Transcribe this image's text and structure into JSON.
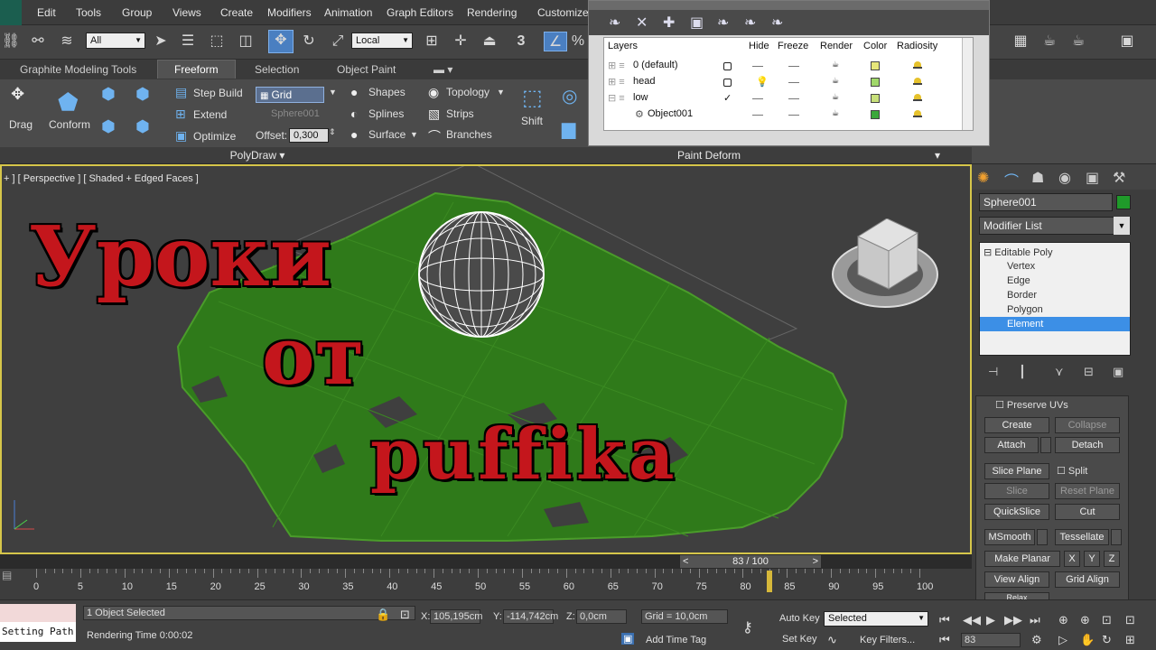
{
  "menu": [
    "Edit",
    "Tools",
    "Group",
    "Views",
    "Create",
    "Modifiers",
    "Animation",
    "Graph Editors",
    "Rendering",
    "Customize"
  ],
  "toolbar": {
    "selection_filter": "All",
    "reference_coord": "Local",
    "snap_label": "3",
    "percent_label": "%"
  },
  "ribbon_tabs": [
    "Graphite Modeling Tools",
    "Freeform",
    "Selection",
    "Object Paint"
  ],
  "ribbon": {
    "drag": "Drag",
    "conform": "Conform",
    "step_build": "Step Build",
    "extend": "Extend",
    "optimize": "Optimize",
    "grid": "Grid",
    "draw_on": "Sphere001",
    "offset_label": "Offset:",
    "offset_value": "0,300",
    "shapes": "Shapes",
    "splines": "Splines",
    "surface": "Surface",
    "topology": "Topology",
    "strips": "Strips",
    "branches": "Branches",
    "shift": "Shift",
    "polydraw": "PolyDraw",
    "paint_deform": "Paint Deform"
  },
  "layer_dialog": {
    "headers": [
      "Layers",
      "Hide",
      "Freeze",
      "Render",
      "Color",
      "Radiosity"
    ],
    "rows": [
      {
        "name": "0 (default)",
        "color": "#e6e67a",
        "icon": "checkbox-icon"
      },
      {
        "name": "head",
        "color": "#a0d86a",
        "icon": "bulb-icon"
      },
      {
        "name": "low",
        "color": "#c8e07a",
        "icon": "check-icon"
      },
      {
        "name": "Object001",
        "color": "#3aa83a",
        "icon": "none"
      }
    ]
  },
  "viewport": {
    "label": "+ ] [ Perspective ] [ Shaded + Edged Faces ]",
    "overlay_line1": "Уроки",
    "overlay_line2": "от",
    "overlay_line3": "puffika"
  },
  "command_panel": {
    "object_name": "Sphere001",
    "modifier_list": "Modifier List",
    "stack": [
      "Editable Poly",
      "Vertex",
      "Edge",
      "Border",
      "Polygon",
      "Element"
    ],
    "selected_index": 5,
    "preserve_uvs": "Preserve UVs",
    "create": "Create",
    "collapse": "Collapse",
    "attach": "Attach",
    "detach": "Detach",
    "slice_plane": "Slice Plane",
    "split": "Split",
    "slice": "Slice",
    "reset_plane": "Reset Plane",
    "quickslice": "QuickSlice",
    "cut": "Cut",
    "msmooth": "MSmooth",
    "tessellate": "Tessellate",
    "make_planar": "Make Planar",
    "x": "X",
    "y": "Y",
    "z": "Z",
    "view_align": "View Align",
    "grid_align": "Grid Align",
    "relax": "Relax"
  },
  "timeline": {
    "slider_text": "83 / 100",
    "current_frame": 83,
    "ticks": [
      "0",
      "5",
      "10",
      "15",
      "20",
      "25",
      "30",
      "35",
      "40",
      "45",
      "50",
      "55",
      "60",
      "65",
      "70",
      "75",
      "80",
      "85",
      "90",
      "95",
      "100"
    ]
  },
  "status": {
    "script_text": "Setting Path",
    "selected": "1 Object Selected",
    "render_time": "Rendering Time  0:00:02",
    "x_label": "X:",
    "x_value": "105,195cm",
    "y_label": "Y:",
    "y_value": "-114,742cm",
    "z_label": "Z:",
    "z_value": "0,0cm",
    "grid": "Grid = 10,0cm",
    "add_time_tag": "Add Time Tag",
    "auto_key": "Auto Key",
    "set_key": "Set Key",
    "key_mode": "Selected",
    "key_filters": "Key Filters...",
    "frame_field": "83"
  }
}
